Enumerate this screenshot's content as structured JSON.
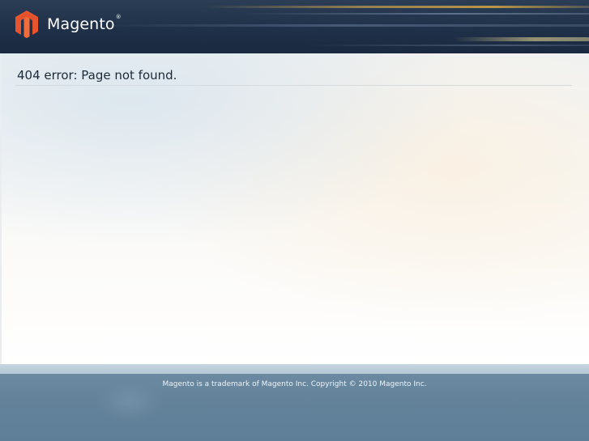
{
  "header": {
    "logo_text": "Magento",
    "logo_registered": "®",
    "logo_icon": "magento-logo-icon",
    "colors": {
      "background": "#1f3049",
      "logo_mark": "#e8542d"
    }
  },
  "main": {
    "title": "404 error: Page not found."
  },
  "footer": {
    "copyright": "Magento is a trademark of Magento Inc. Copyright © 2010 Magento Inc.",
    "colors": {
      "background": "#62829a",
      "band": "#b4c7d4"
    }
  }
}
